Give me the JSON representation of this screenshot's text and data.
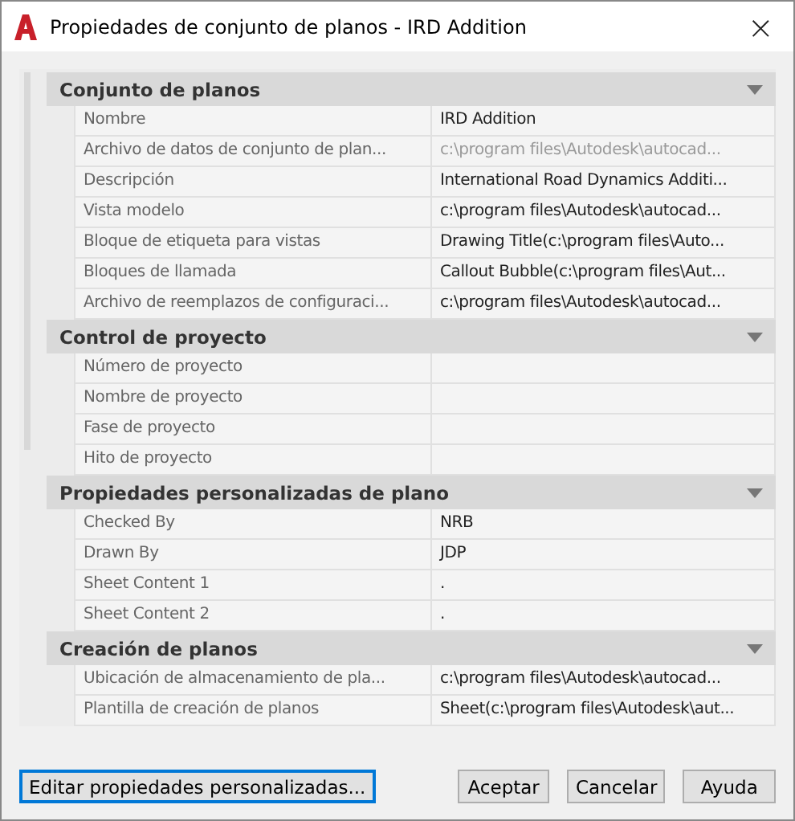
{
  "window": {
    "title": "Propiedades de conjunto de planos - IRD Addition",
    "close": "×"
  },
  "sections": [
    {
      "title": "Conjunto de planos",
      "expanded": true,
      "rows": [
        {
          "label": "Nombre",
          "value": "IRD Addition",
          "disabled": false
        },
        {
          "label": "Archivo de datos de conjunto de plan...",
          "value": "c:\\program files\\Autodesk\\autocad...",
          "disabled": true
        },
        {
          "label": "Descripción",
          "value": "International Road Dynamics Additi...",
          "disabled": false
        },
        {
          "label": "Vista modelo",
          "value": "c:\\program files\\Autodesk\\autocad...",
          "disabled": false
        },
        {
          "label": "Bloque de etiqueta para vistas",
          "value": "Drawing Title(c:\\program files\\Auto...",
          "disabled": false
        },
        {
          "label": "Bloques de llamada",
          "value": "Callout Bubble(c:\\program files\\Aut...",
          "disabled": false
        },
        {
          "label": "Archivo de reemplazos de configuraci...",
          "value": "c:\\program files\\Autodesk\\autocad...",
          "disabled": false
        }
      ]
    },
    {
      "title": "Control de proyecto",
      "expanded": true,
      "rows": [
        {
          "label": "Número de proyecto",
          "value": "",
          "disabled": false
        },
        {
          "label": "Nombre de proyecto",
          "value": "",
          "disabled": false
        },
        {
          "label": "Fase de proyecto",
          "value": "",
          "disabled": false
        },
        {
          "label": "Hito de proyecto",
          "value": "",
          "disabled": false
        }
      ]
    },
    {
      "title": "Propiedades personalizadas de plano",
      "expanded": true,
      "rows": [
        {
          "label": "Checked By",
          "value": "NRB",
          "disabled": false
        },
        {
          "label": "Drawn By",
          "value": "JDP",
          "disabled": false
        },
        {
          "label": "Sheet Content 1",
          "value": ".",
          "disabled": false
        },
        {
          "label": "Sheet Content 2",
          "value": ".",
          "disabled": false
        }
      ]
    },
    {
      "title": "Creación de planos",
      "expanded": true,
      "rows": [
        {
          "label": "Ubicación de almacenamiento de pla...",
          "value": "c:\\program files\\Autodesk\\autocad...",
          "disabled": false
        },
        {
          "label": "Plantilla de creación de planos",
          "value": "Sheet(c:\\program files\\Autodesk\\aut...",
          "disabled": false
        }
      ]
    }
  ],
  "buttons": [
    {
      "label": "Editar propiedades personalizadas...",
      "kind": "focused"
    },
    {
      "label": "Aceptar",
      "kind": "normal"
    },
    {
      "label": "Cancelar",
      "kind": "normal"
    },
    {
      "label": "Ayuda",
      "kind": "normal"
    }
  ]
}
